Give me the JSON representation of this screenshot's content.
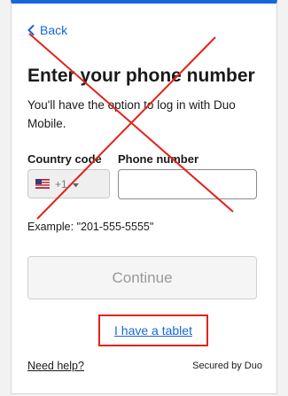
{
  "nav": {
    "back_label": "Back"
  },
  "form": {
    "title": "Enter your phone number",
    "description": "You'll have the option to log in with Duo Mobile.",
    "country_label": "Country code",
    "country_value": "+1",
    "phone_label": "Phone number",
    "phone_value": "",
    "example": "Example: \"201-555-5555\"",
    "continue_label": "Continue"
  },
  "links": {
    "tablet_label": "I have a tablet",
    "help_label": "Need help?"
  },
  "footer": {
    "secured_label": "Secured by Duo"
  },
  "colors": {
    "accent": "#1667d9",
    "annotation": "#e2231a"
  },
  "icons": {
    "back": "chevron-left-icon",
    "flag": "us-flag-icon",
    "dropdown": "caret-down-icon"
  }
}
